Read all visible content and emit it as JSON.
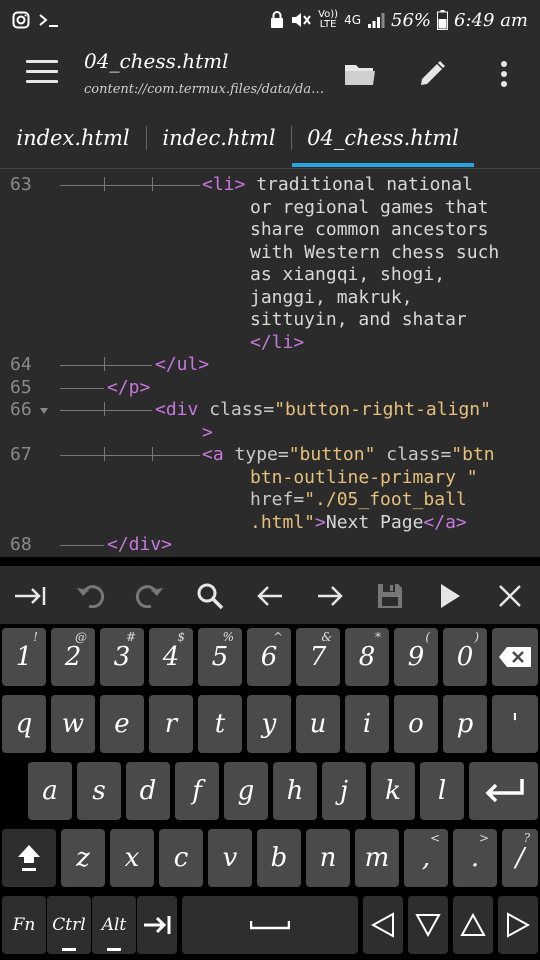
{
  "status_bar": {
    "network_label_top": "Vo))",
    "network_label_bottom": "LTE",
    "signal_label": "4G",
    "battery": "56%",
    "time": "6:49 am"
  },
  "app_bar": {
    "title": "04_chess.html",
    "subtitle": "content://com.termux.files/data/da…"
  },
  "tabs": [
    {
      "label": "index.html"
    },
    {
      "label": "indec.html"
    },
    {
      "label": "04_chess.html"
    }
  ],
  "editor": {
    "line_numbers": [
      "63",
      "64",
      "65",
      "66",
      "67",
      "68"
    ],
    "lines": [
      {
        "tag_open": "<li>",
        "text1": " traditional national",
        "text2": "or regional games that",
        "text3": "share common ancestors",
        "text4": "with Western chess such",
        "text5": "as xiangqi, shogi,",
        "text6": "janggi, makruk,",
        "text7": "sittuyin, and shatar",
        "tag_close": "</li>"
      },
      {
        "code": "</ul>"
      },
      {
        "code": "</p>"
      },
      {
        "tag": "<div",
        "attr": " class=",
        "str": "\"button-right-align\"",
        "end": ">"
      },
      {
        "tag": "<a",
        "attr1": " type=",
        "str1": "\"button\"",
        "attr2": " class=",
        "str2a": "\"btn",
        "str2b": "btn-outline-primary \"",
        "attr3": "href=",
        "str3a": "\"./05_foot_ball",
        "str3b": ".html\"",
        "text": "Next Page",
        "close": "</a>"
      },
      {
        "code": "</div>"
      }
    ]
  },
  "toolbar": {
    "icons": [
      "tab-icon",
      "undo-icon",
      "redo-icon",
      "search-icon",
      "arrow-left-icon",
      "arrow-right-icon",
      "save-icon",
      "run-icon",
      "close-icon"
    ]
  },
  "keyboard": {
    "row1": [
      {
        "k": "1",
        "s": "!"
      },
      {
        "k": "2",
        "s": "@"
      },
      {
        "k": "3",
        "s": "#"
      },
      {
        "k": "4",
        "s": "$"
      },
      {
        "k": "5",
        "s": "%"
      },
      {
        "k": "6",
        "s": "^"
      },
      {
        "k": "7",
        "s": "&"
      },
      {
        "k": "8",
        "s": "*"
      },
      {
        "k": "9",
        "s": "("
      },
      {
        "k": "0",
        "s": ")"
      }
    ],
    "row2": [
      "q",
      "w",
      "e",
      "r",
      "t",
      "y",
      "u",
      "i",
      "o",
      "p"
    ],
    "row2_extra": "'",
    "row3": [
      "a",
      "s",
      "d",
      "f",
      "g",
      "h",
      "j",
      "k",
      "l"
    ],
    "row4": [
      "z",
      "x",
      "c",
      "v",
      "b",
      "n",
      "m"
    ],
    "row4_punct": [
      ",",
      ".",
      "/"
    ],
    "row4_punct_sup": [
      "<",
      ">",
      "?"
    ],
    "mods": {
      "fn": "Fn",
      "ctrl": "Ctrl",
      "alt": "Alt"
    },
    "colors": {
      "key_bg": "#4a4a4a",
      "accent": "#29a3e0"
    }
  }
}
